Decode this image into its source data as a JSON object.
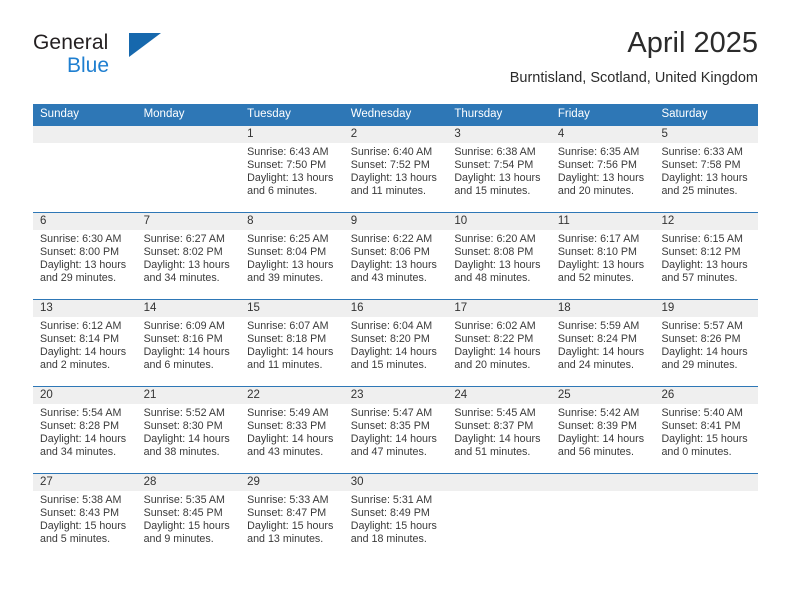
{
  "brand": {
    "name_part1": "General",
    "name_part2": "Blue",
    "triangle_icon": "triangle-icon",
    "accent_blue": "#1f7fd0",
    "triangle_blue": "#1668ad"
  },
  "header": {
    "month_title": "April 2025",
    "location": "Burntisland, Scotland, United Kingdom"
  },
  "calendar": {
    "header_bg": "#2e77b6",
    "dateband_bg": "#efefef",
    "weekday_headers": [
      "Sunday",
      "Monday",
      "Tuesday",
      "Wednesday",
      "Thursday",
      "Friday",
      "Saturday"
    ],
    "weeks": [
      [
        {
          "day": "",
          "sunrise": "",
          "sunset": "",
          "daylight_line1": "",
          "daylight_line2": ""
        },
        {
          "day": "",
          "sunrise": "",
          "sunset": "",
          "daylight_line1": "",
          "daylight_line2": ""
        },
        {
          "day": "1",
          "sunrise": "Sunrise: 6:43 AM",
          "sunset": "Sunset: 7:50 PM",
          "daylight_line1": "Daylight: 13 hours",
          "daylight_line2": "and 6 minutes."
        },
        {
          "day": "2",
          "sunrise": "Sunrise: 6:40 AM",
          "sunset": "Sunset: 7:52 PM",
          "daylight_line1": "Daylight: 13 hours",
          "daylight_line2": "and 11 minutes."
        },
        {
          "day": "3",
          "sunrise": "Sunrise: 6:38 AM",
          "sunset": "Sunset: 7:54 PM",
          "daylight_line1": "Daylight: 13 hours",
          "daylight_line2": "and 15 minutes."
        },
        {
          "day": "4",
          "sunrise": "Sunrise: 6:35 AM",
          "sunset": "Sunset: 7:56 PM",
          "daylight_line1": "Daylight: 13 hours",
          "daylight_line2": "and 20 minutes."
        },
        {
          "day": "5",
          "sunrise": "Sunrise: 6:33 AM",
          "sunset": "Sunset: 7:58 PM",
          "daylight_line1": "Daylight: 13 hours",
          "daylight_line2": "and 25 minutes."
        }
      ],
      [
        {
          "day": "6",
          "sunrise": "Sunrise: 6:30 AM",
          "sunset": "Sunset: 8:00 PM",
          "daylight_line1": "Daylight: 13 hours",
          "daylight_line2": "and 29 minutes."
        },
        {
          "day": "7",
          "sunrise": "Sunrise: 6:27 AM",
          "sunset": "Sunset: 8:02 PM",
          "daylight_line1": "Daylight: 13 hours",
          "daylight_line2": "and 34 minutes."
        },
        {
          "day": "8",
          "sunrise": "Sunrise: 6:25 AM",
          "sunset": "Sunset: 8:04 PM",
          "daylight_line1": "Daylight: 13 hours",
          "daylight_line2": "and 39 minutes."
        },
        {
          "day": "9",
          "sunrise": "Sunrise: 6:22 AM",
          "sunset": "Sunset: 8:06 PM",
          "daylight_line1": "Daylight: 13 hours",
          "daylight_line2": "and 43 minutes."
        },
        {
          "day": "10",
          "sunrise": "Sunrise: 6:20 AM",
          "sunset": "Sunset: 8:08 PM",
          "daylight_line1": "Daylight: 13 hours",
          "daylight_line2": "and 48 minutes."
        },
        {
          "day": "11",
          "sunrise": "Sunrise: 6:17 AM",
          "sunset": "Sunset: 8:10 PM",
          "daylight_line1": "Daylight: 13 hours",
          "daylight_line2": "and 52 minutes."
        },
        {
          "day": "12",
          "sunrise": "Sunrise: 6:15 AM",
          "sunset": "Sunset: 8:12 PM",
          "daylight_line1": "Daylight: 13 hours",
          "daylight_line2": "and 57 minutes."
        }
      ],
      [
        {
          "day": "13",
          "sunrise": "Sunrise: 6:12 AM",
          "sunset": "Sunset: 8:14 PM",
          "daylight_line1": "Daylight: 14 hours",
          "daylight_line2": "and 2 minutes."
        },
        {
          "day": "14",
          "sunrise": "Sunrise: 6:09 AM",
          "sunset": "Sunset: 8:16 PM",
          "daylight_line1": "Daylight: 14 hours",
          "daylight_line2": "and 6 minutes."
        },
        {
          "day": "15",
          "sunrise": "Sunrise: 6:07 AM",
          "sunset": "Sunset: 8:18 PM",
          "daylight_line1": "Daylight: 14 hours",
          "daylight_line2": "and 11 minutes."
        },
        {
          "day": "16",
          "sunrise": "Sunrise: 6:04 AM",
          "sunset": "Sunset: 8:20 PM",
          "daylight_line1": "Daylight: 14 hours",
          "daylight_line2": "and 15 minutes."
        },
        {
          "day": "17",
          "sunrise": "Sunrise: 6:02 AM",
          "sunset": "Sunset: 8:22 PM",
          "daylight_line1": "Daylight: 14 hours",
          "daylight_line2": "and 20 minutes."
        },
        {
          "day": "18",
          "sunrise": "Sunrise: 5:59 AM",
          "sunset": "Sunset: 8:24 PM",
          "daylight_line1": "Daylight: 14 hours",
          "daylight_line2": "and 24 minutes."
        },
        {
          "day": "19",
          "sunrise": "Sunrise: 5:57 AM",
          "sunset": "Sunset: 8:26 PM",
          "daylight_line1": "Daylight: 14 hours",
          "daylight_line2": "and 29 minutes."
        }
      ],
      [
        {
          "day": "20",
          "sunrise": "Sunrise: 5:54 AM",
          "sunset": "Sunset: 8:28 PM",
          "daylight_line1": "Daylight: 14 hours",
          "daylight_line2": "and 34 minutes."
        },
        {
          "day": "21",
          "sunrise": "Sunrise: 5:52 AM",
          "sunset": "Sunset: 8:30 PM",
          "daylight_line1": "Daylight: 14 hours",
          "daylight_line2": "and 38 minutes."
        },
        {
          "day": "22",
          "sunrise": "Sunrise: 5:49 AM",
          "sunset": "Sunset: 8:33 PM",
          "daylight_line1": "Daylight: 14 hours",
          "daylight_line2": "and 43 minutes."
        },
        {
          "day": "23",
          "sunrise": "Sunrise: 5:47 AM",
          "sunset": "Sunset: 8:35 PM",
          "daylight_line1": "Daylight: 14 hours",
          "daylight_line2": "and 47 minutes."
        },
        {
          "day": "24",
          "sunrise": "Sunrise: 5:45 AM",
          "sunset": "Sunset: 8:37 PM",
          "daylight_line1": "Daylight: 14 hours",
          "daylight_line2": "and 51 minutes."
        },
        {
          "day": "25",
          "sunrise": "Sunrise: 5:42 AM",
          "sunset": "Sunset: 8:39 PM",
          "daylight_line1": "Daylight: 14 hours",
          "daylight_line2": "and 56 minutes."
        },
        {
          "day": "26",
          "sunrise": "Sunrise: 5:40 AM",
          "sunset": "Sunset: 8:41 PM",
          "daylight_line1": "Daylight: 15 hours",
          "daylight_line2": "and 0 minutes."
        }
      ],
      [
        {
          "day": "27",
          "sunrise": "Sunrise: 5:38 AM",
          "sunset": "Sunset: 8:43 PM",
          "daylight_line1": "Daylight: 15 hours",
          "daylight_line2": "and 5 minutes."
        },
        {
          "day": "28",
          "sunrise": "Sunrise: 5:35 AM",
          "sunset": "Sunset: 8:45 PM",
          "daylight_line1": "Daylight: 15 hours",
          "daylight_line2": "and 9 minutes."
        },
        {
          "day": "29",
          "sunrise": "Sunrise: 5:33 AM",
          "sunset": "Sunset: 8:47 PM",
          "daylight_line1": "Daylight: 15 hours",
          "daylight_line2": "and 13 minutes."
        },
        {
          "day": "30",
          "sunrise": "Sunrise: 5:31 AM",
          "sunset": "Sunset: 8:49 PM",
          "daylight_line1": "Daylight: 15 hours",
          "daylight_line2": "and 18 minutes."
        },
        {
          "day": "",
          "sunrise": "",
          "sunset": "",
          "daylight_line1": "",
          "daylight_line2": ""
        },
        {
          "day": "",
          "sunrise": "",
          "sunset": "",
          "daylight_line1": "",
          "daylight_line2": ""
        },
        {
          "day": "",
          "sunrise": "",
          "sunset": "",
          "daylight_line1": "",
          "daylight_line2": ""
        }
      ]
    ]
  }
}
